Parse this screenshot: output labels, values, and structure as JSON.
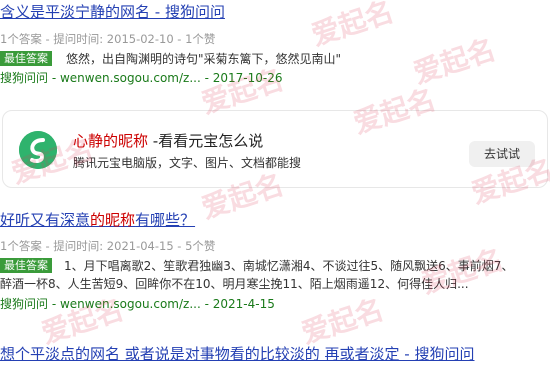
{
  "results": [
    {
      "title_parts": [
        "含义是平淡宁静的网名 - 搜狗问问"
      ],
      "meta": "1个答案 - 提问时间: 2015-02-10 - 1个赞",
      "best_label": "最佳答案",
      "answer": "悠然，出自陶渊明的诗句\"采菊东篱下，悠然见南山\"",
      "source_name": "搜狗问问",
      "source_url": " - wenwen.sogou.com/z... - 2017-10-26"
    },
    {
      "title_prefix": "好听又有深意",
      "title_hl1": "的",
      "title_hl2": "昵称",
      "title_suffix": "有哪些？",
      "meta": "1个答案 - 提问时间: 2021-04-15 - 5个赞",
      "best_label": "最佳答案",
      "answer_line1": "1、月下唱离歌2、笙歌君独幽3、南城忆潇湘4、不谈过往5、随风飘送6、事前烟7、",
      "answer_line2": "醉酒一杯8、人生苦短9、回眸你不在10、明月寒尘挽11、陌上烟雨遥12、何得佳人归...",
      "source_name": "搜狗问问",
      "source_url": " - wenwen.sogou.com/z... - 2021-4-15"
    },
    {
      "title": "想个平淡点的网名 或者说是对事物看的比较淡的 再或者淡定 - 搜狗问问"
    }
  ],
  "promo": {
    "title_hl": "心静的昵称",
    "title_rest": " -看看元宝怎么说",
    "desc": "腾讯元宝电脑版，文字、图片、文档都能搜",
    "button": "去试试",
    "logo_icon": "yuanbao-logo-icon",
    "brand_color": "#2fb36d"
  },
  "watermark": "爱起名"
}
